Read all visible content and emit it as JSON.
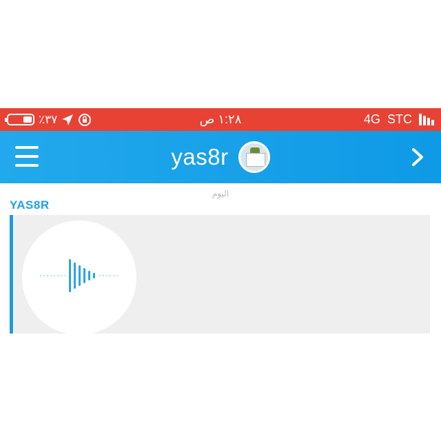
{
  "status_bar": {
    "battery_percent": "٪٣٧",
    "battery_level": 0.37,
    "time": "١:٢٨ ص",
    "network": "4G",
    "carrier": "STC"
  },
  "header": {
    "title": "yas8r"
  },
  "chat": {
    "date_label": "اليوم",
    "sender": "YAS8R"
  },
  "colors": {
    "status_bar": "#e84235",
    "header": "#1ea0e8",
    "sender_text": "#1ea0e8",
    "message_bg": "#efefef"
  },
  "icons": {
    "menu": "menu-icon",
    "avatar": "avatar",
    "next": "chevron-right-icon",
    "voice": "waveform-icon"
  }
}
